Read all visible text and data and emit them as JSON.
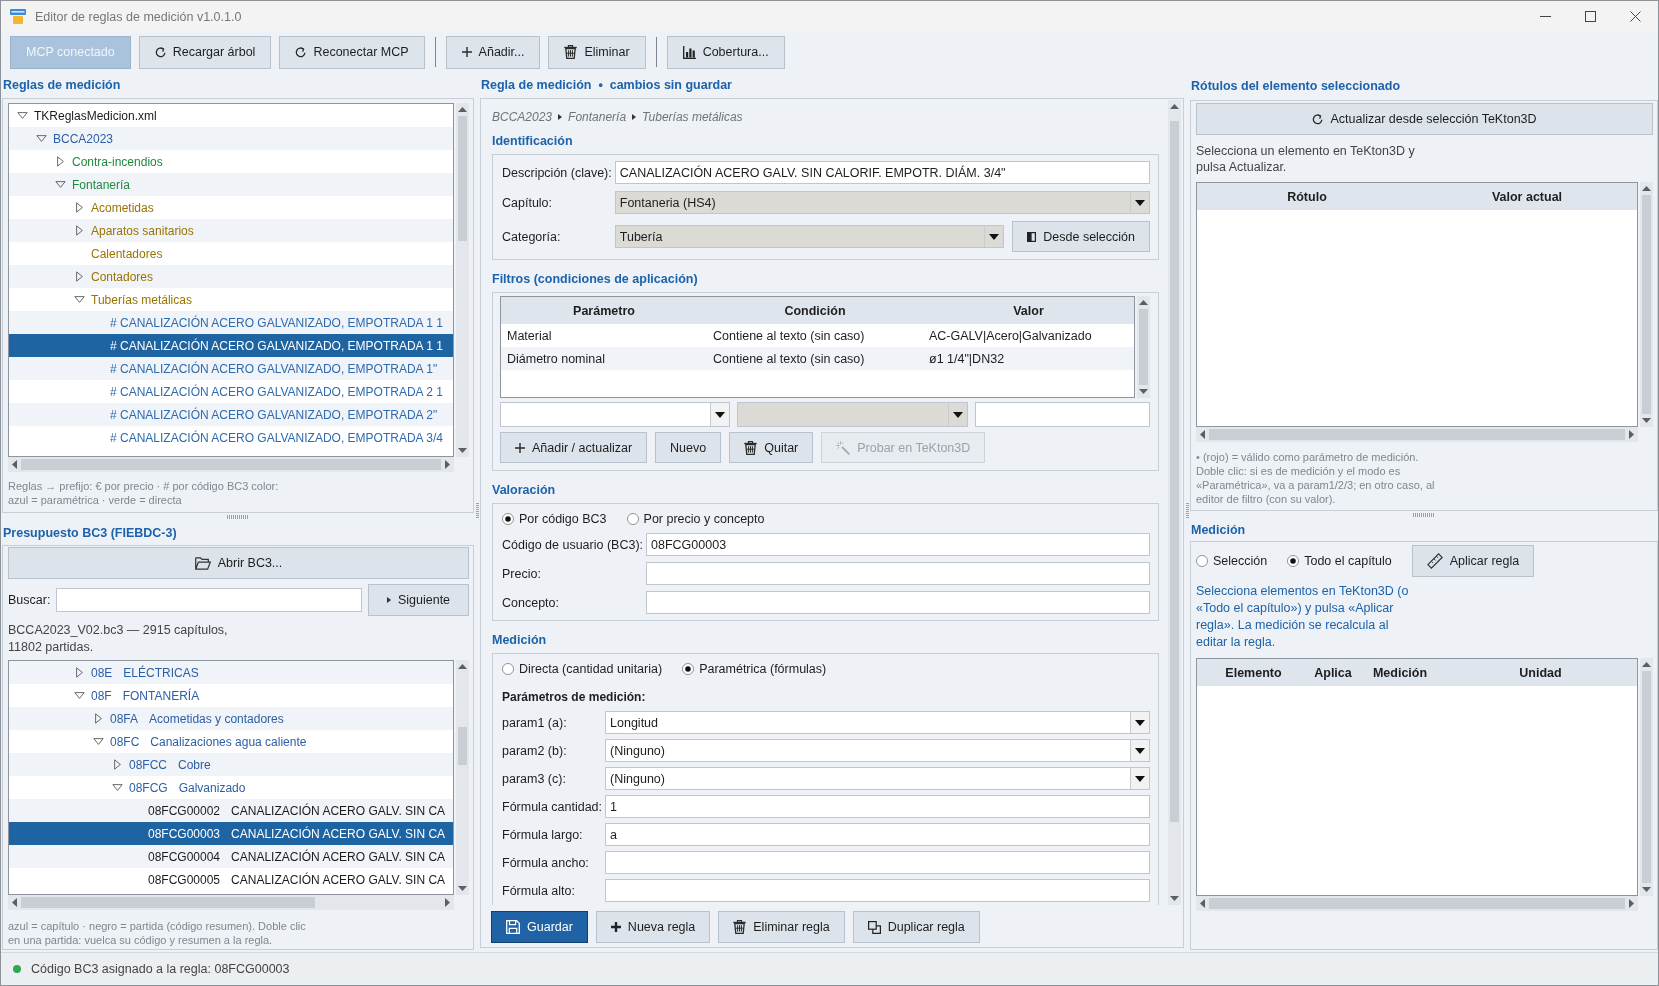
{
  "window": {
    "title": "Editor de reglas de medición v1.0.1.0"
  },
  "toolbar": {
    "groups": [
      [
        {
          "label": "MCP conectado",
          "kind": "status",
          "connected": true
        },
        {
          "label": "Recargar árbol",
          "kind": "action"
        },
        {
          "label": "Reconectar MCP",
          "kind": "action"
        }
      ],
      [
        {
          "label": "Añadir...",
          "kind": "action"
        },
        {
          "label": "Eliminar",
          "kind": "action"
        }
      ],
      [
        {
          "label": "Cobertura...",
          "kind": "action"
        }
      ]
    ]
  },
  "rules_panel": {
    "title": "Reglas de medición",
    "tree": [
      {
        "label": "TKReglasMedicion.xml",
        "color": "#1b1b1b",
        "expanded": true,
        "selected": false,
        "children": [
          {
            "label": "BCCA2023",
            "color": "#2b5ea6",
            "expanded": true,
            "selected": false,
            "children": [
              {
                "label": "Contra-incendios",
                "color": "#1f8a3e",
                "expanded": false,
                "selected": false
              },
              {
                "label": "Fontanería",
                "color": "#1f8a3e",
                "expanded": true,
                "selected": false,
                "children": [
                  {
                    "label": "Acometidas",
                    "color": "#9a7300",
                    "expanded": false,
                    "selected": false
                  },
                  {
                    "label": "Aparatos sanitarios",
                    "color": "#9a7300",
                    "expanded": false,
                    "selected": false
                  },
                  {
                    "label": "Calentadores",
                    "color": "#9a7300",
                    "selected": false
                  },
                  {
                    "label": "Contadores",
                    "color": "#9a7300",
                    "expanded": false,
                    "selected": false
                  },
                  {
                    "label": "Tuberías metálicas",
                    "color": "#9a7300",
                    "expanded": true,
                    "selected": false,
                    "children": [
                      {
                        "label": "# CANALIZACIÓN ACERO GALVANIZADO, EMPOTRADA 1 1",
                        "color": "#2e6bb0",
                        "selected": false
                      },
                      {
                        "label": "# CANALIZACIÓN ACERO GALVANIZADO, EMPOTRADA 1 1",
                        "selected": true
                      },
                      {
                        "label": "# CANALIZACIÓN ACERO GALVANIZADO, EMPOTRADA 1\"",
                        "color": "#2e6bb0",
                        "selected": false
                      },
                      {
                        "label": "# CANALIZACIÓN ACERO GALVANIZADO, EMPOTRADA 2 1",
                        "color": "#2e6bb0",
                        "selected": false
                      },
                      {
                        "label": "# CANALIZACIÓN ACERO GALVANIZADO, EMPOTRADA 2\"",
                        "color": "#2e6bb0",
                        "selected": false
                      },
                      {
                        "label": "# CANALIZACIÓN ACERO GALVANIZADO, EMPOTRADA 3/4",
                        "color": "#2e6bb0",
                        "selected": false
                      }
                    ]
                  }
                ]
              }
            ]
          }
        ]
      }
    ],
    "legend": "Reglas → prefijo: € por precio · # por código BC3 color: azul = paramétrica · verde = directa"
  },
  "bc3_panel": {
    "title": "Presupuesto BC3 (FIEBDC-3)",
    "open_button": "Abrir BC3...",
    "search": {
      "label": "Buscar:"
    },
    "next_button": "Siguiente",
    "info": "BCCA2023_V02.bc3 — 2915 capítulos, 11802 partidas.",
    "tree": [
      {
        "code": "08E",
        "name": "ELÉCTRICAS",
        "color": "#2b5ea6",
        "expanded": false,
        "selected": false
      },
      {
        "code": "08F",
        "name": "FONTANERÍA",
        "color": "#2b5ea6",
        "expanded": true,
        "selected": false,
        "children": [
          {
            "code": "08FA",
            "name": "Acometidas y contadores",
            "color": "#2b5ea6",
            "expanded": false,
            "selected": false
          },
          {
            "code": "08FC",
            "name": "Canalizaciones agua caliente",
            "color": "#2b5ea6",
            "expanded": true,
            "selected": false,
            "children": [
              {
                "code": "08FCC",
                "name": "Cobre",
                "color": "#2b5ea6",
                "expanded": false,
                "selected": false
              },
              {
                "code": "08FCG",
                "name": "Galvanizado",
                "color": "#2b5ea6",
                "expanded": true,
                "selected": false,
                "children": [
                  {
                    "code": "08FCG00002",
                    "name": "CANALIZACIÓN ACERO GALV. SIN CA",
                    "color": "#1b1b1b",
                    "selected": false
                  },
                  {
                    "code": "08FCG00003",
                    "name": "CANALIZACIÓN ACERO GALV. SIN CA",
                    "selected": true
                  },
                  {
                    "code": "08FCG00004",
                    "name": "CANALIZACIÓN ACERO GALV. SIN CA",
                    "color": "#1b1b1b",
                    "selected": false
                  },
                  {
                    "code": "08FCG00005",
                    "name": "CANALIZACIÓN ACERO GALV. SIN CA",
                    "color": "#1b1b1b",
                    "selected": false
                  }
                ]
              }
            ]
          }
        ]
      }
    ],
    "legend": "azul = capítulo · negro = partida (código resumen). Doble clic en una partida: vuelca su código y resumen a la regla."
  },
  "rule_editor": {
    "title": "Regla de medición  •  cambios sin guardar",
    "breadcrumb": [
      "BCCA2023",
      "Fontanería",
      "Tuberías metálicas"
    ],
    "identification": {
      "title": "Identificación",
      "description": {
        "label": "Descripción (clave):",
        "value": "CANALIZACIÓN ACERO GALV. SIN CALORIF. EMPOTR. DIÁM. 3/4\""
      },
      "chapter": {
        "label": "Capítulo:",
        "value": "Fontaneria (HS4)",
        "editable": false
      },
      "category": {
        "label": "Categoría:",
        "value": "Tubería",
        "editable": false
      },
      "from_selection_button": "Desde selección"
    },
    "filters": {
      "title": "Filtros (condiciones de aplicación)",
      "table": {
        "columns": [
          "Parámetro",
          "Condición",
          "Valor"
        ],
        "rows": [
          [
            "Material",
            "Contiene al texto (sin caso)",
            "AC-GALV|Acero|Galvanizado"
          ],
          [
            "Diámetro nominal",
            "Contiene al texto (sin caso)",
            "ø1 1/4\"|DN32"
          ]
        ]
      },
      "editor": {
        "parameter": {
          "editable": true
        },
        "condition": {
          "editable": false
        }
      },
      "buttons": [
        {
          "label": "Añadir / actualizar",
          "disabled": false
        },
        {
          "label": "Nuevo",
          "disabled": false
        },
        {
          "label": "Quitar",
          "disabled": false
        },
        {
          "label": "Probar en TeKton3D",
          "disabled": true
        }
      ]
    },
    "valuation": {
      "title": "Valoración",
      "options": [
        {
          "label": "Por código BC3",
          "selected": true
        },
        {
          "label": "Por precio y concepto",
          "selected": false
        }
      ],
      "fields": [
        {
          "label": "Código de usuario (BC3):",
          "value": "08FCG00003"
        },
        {
          "label": "Precio:"
        },
        {
          "label": "Concepto:"
        }
      ]
    },
    "measurement": {
      "title": "Medición",
      "options": [
        {
          "label": "Directa (cantidad unitaria)",
          "selected": false
        },
        {
          "label": "Paramétrica (fórmulas)",
          "selected": true
        }
      ],
      "params_title": "Parámetros de medición:",
      "fields": [
        {
          "label": "param1 (a):",
          "kind": "combo",
          "value": "Longitud",
          "editable": true
        },
        {
          "label": "param2 (b):",
          "kind": "combo",
          "value": "(Ninguno)",
          "editable": true
        },
        {
          "label": "param3 (c):",
          "kind": "combo",
          "value": "(Ninguno)",
          "editable": true
        },
        {
          "label": "Fórmula cantidad:",
          "kind": "text",
          "value": "1"
        },
        {
          "label": "Fórmula largo:",
          "kind": "text",
          "value": "a"
        },
        {
          "label": "Fórmula ancho:",
          "kind": "text"
        },
        {
          "label": "Fórmula alto:",
          "kind": "text"
        }
      ]
    },
    "actions": [
      {
        "label": "Guardar",
        "kind": "primary"
      },
      {
        "label": "Nueva regla",
        "kind": "normal"
      },
      {
        "label": "Eliminar regla",
        "kind": "normal"
      },
      {
        "label": "Duplicar regla",
        "kind": "normal"
      }
    ]
  },
  "labels_panel": {
    "title": "Rótulos del elemento seleccionado",
    "refresh_button": "Actualizar desde selección TeKton3D",
    "hint": "Selecciona un elemento en TeKton3D y pulsa Actualizar.",
    "table": {
      "columns": [
        "Rótulo",
        "Valor actual"
      ]
    },
    "note": "• (rojo) = válido como parámetro de medición. Doble clic: si es de medición y el modo es «Paramétrica», va a param1/2/3; en otro caso, al editor de filtro (con su valor)."
  },
  "measure_panel": {
    "title": "Medición",
    "options": [
      {
        "label": "Selección",
        "selected": false
      },
      {
        "label": "Todo el capítulo",
        "selected": true
      }
    ],
    "apply_button": "Aplicar regla",
    "hint": "Selecciona elementos en TeKton3D (o «Todo el capítulo») y pulsa «Aplicar regla». La medición se recalcula al editar la regla.",
    "table": {
      "columns": [
        "Elemento",
        "Aplica",
        "Medición",
        "Unidad"
      ]
    }
  },
  "status_bar": {
    "text": "Código BC3 asignado a la regla: 08FCG00003"
  }
}
